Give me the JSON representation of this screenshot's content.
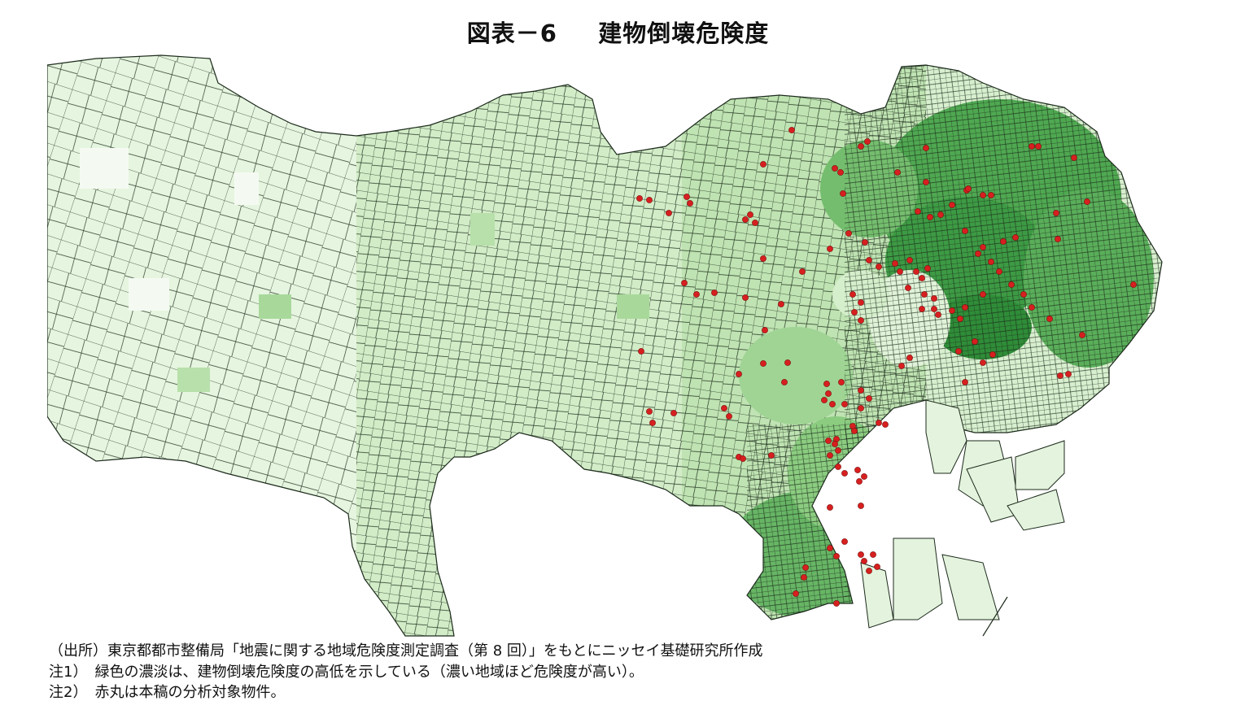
{
  "title": {
    "label": "図表－6",
    "text": "建物倒壊危険度"
  },
  "map": {
    "legend_meaning": "緑色の濃淡は、建物倒壊危険度の高低を示している（濃い地域ほど危険度が高い）。",
    "colors": {
      "level_1": "#e3f3dc",
      "level_2": "#c2e5b5",
      "level_3": "#98d38b",
      "level_4": "#5fb35c",
      "level_5": "#2d8a37",
      "borders": "#1f2a1f",
      "marker": "#d71f1f",
      "water": "#ffffff"
    },
    "markers_meaning": "赤丸は本稿の分析対象物件。"
  },
  "notes": {
    "source": "（出所）東京都都市整備局「地震に関する地域危険度測定調査（第 8 回）」をもとにニッセイ基礎研究所作成",
    "note1": "注1）　緑色の濃淡は、建物倒壊危険度の高低を示している（濃い地域ほど危険度が高い）。",
    "note2": "注2）　赤丸は本稿の分析対象物件。"
  }
}
